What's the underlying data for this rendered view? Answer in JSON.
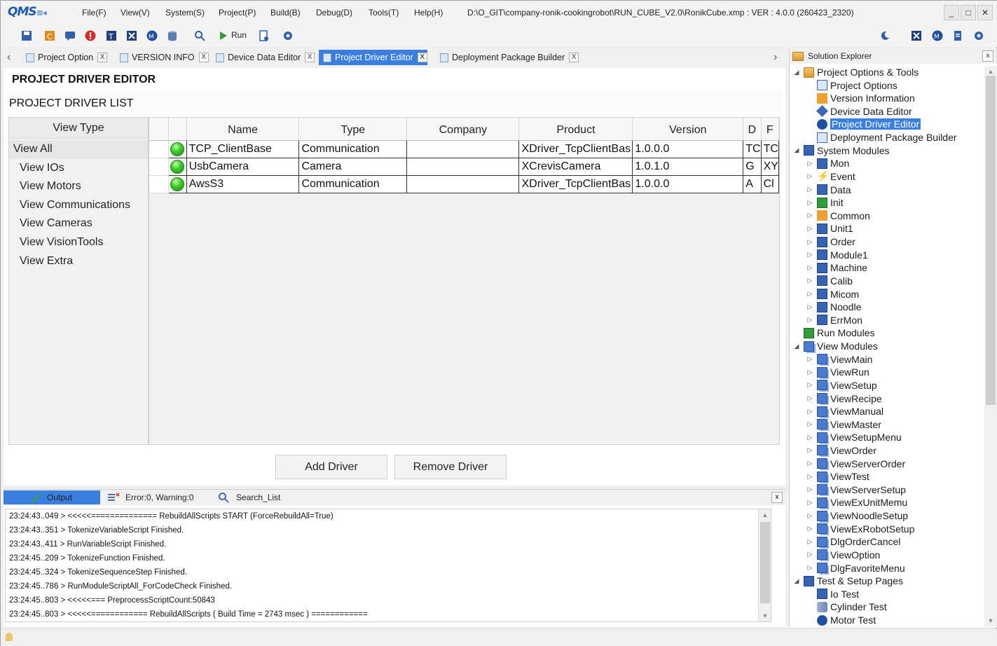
{
  "app": {
    "logo_text": "QMS",
    "path_text": "D:\\O_GIT\\company-ronik-cookingrobot\\RUN_CUBE_V2.0\\RonikCube.xmp :  VER : 4.0.0 (260423_2320)"
  },
  "menu": [
    "File(F)",
    "View(V)",
    "System(S)",
    "Project(P)",
    "Build(B)",
    "Debug(D)",
    "Tools(T)",
    "Help(H)"
  ],
  "toolbar": {
    "run_label": "Run"
  },
  "doc_tabs": [
    {
      "label": "Project Option",
      "close": "X"
    },
    {
      "label": "VERSION INFO",
      "close": "X"
    },
    {
      "label": "Device Data Editor",
      "close": "X"
    },
    {
      "label": "Project Driver Editor",
      "close": "X"
    },
    {
      "label": "Deployment Package Builder",
      "close": "X"
    }
  ],
  "editor": {
    "title": "PROJECT DRIVER EDITOR",
    "list_title": "PROJECT DRIVER LIST",
    "view_type_header": "View Type",
    "view_types": [
      "View All",
      "View IOs",
      "View Motors",
      "View Communications",
      "View Cameras",
      "View VisionTools",
      "View Extra"
    ],
    "columns": [
      "Name",
      "Type",
      "Company",
      "Product",
      "Version",
      "D",
      "F"
    ],
    "rows": [
      {
        "name": "TCP_ClientBase",
        "type": "Communication",
        "company": "",
        "product": "XDriver_TcpClientBas",
        "version": "1.0.0.0",
        "d": "TC",
        "f": "TC"
      },
      {
        "name": "UsbCamera",
        "type": "Camera",
        "company": "",
        "product": "XCrevisCamera",
        "version": "1.0.1.0",
        "d": "G",
        "f": "XY"
      },
      {
        "name": "AwsS3",
        "type": "Communication",
        "company": "",
        "product": "XDriver_TcpClientBas",
        "version": "1.0.0.0",
        "d": "A",
        "f": "Cl"
      }
    ],
    "add_button": "Add Driver",
    "remove_button": "Remove Driver"
  },
  "output": {
    "tabs": [
      "Output",
      "Error:0, Warning:0",
      "Search_List"
    ],
    "close": "x",
    "lines": [
      "23:24:43..049 > <<<<<============== RebuildAllScripts START   (ForceRebuildAll=True)",
      "23:24:43..351 > TokenizeVariableScript Finished.",
      "23:24:43..411 > RunVariableScript Finished.",
      "23:24:45..209 > TokenizeFunction Finished.",
      "23:24:45..324 > TokenizeSequenceStep Finished.",
      "23:24:45..786 > RunModuleScriptAll_ForCodeCheck Finished.",
      "23:24:45..803 > <<<<<=== PreprocessScriptCount:50843",
      "23:24:45..803 > <<<<<============ RebuildAllScripts ( Build Time = 2743 msec ) ============"
    ]
  },
  "solution_explorer": {
    "title": "Solution Explorer",
    "close": "x",
    "nodes": [
      {
        "label": "Project Options & Tools",
        "level": 0,
        "expander": "◢",
        "icon": "folder"
      },
      {
        "label": "Project Options",
        "level": 1,
        "expander": "",
        "icon": "doc"
      },
      {
        "label": "Version Information",
        "level": 1,
        "expander": "",
        "icon": "orange"
      },
      {
        "label": "Device Data Editor",
        "level": 1,
        "expander": "",
        "icon": "cube"
      },
      {
        "label": "Project Driver Editor",
        "level": 1,
        "expander": "",
        "icon": "ring",
        "selected": true
      },
      {
        "label": "Deployment Package Builder",
        "level": 1,
        "expander": "",
        "icon": "doc"
      },
      {
        "label": "System Modules",
        "level": 0,
        "expander": "◢",
        "icon": "mod"
      },
      {
        "label": "Mon",
        "level": 1,
        "expander": "▷",
        "icon": "mod"
      },
      {
        "label": "Event",
        "level": 1,
        "expander": "▷",
        "icon": "bolt"
      },
      {
        "label": "Data",
        "level": 1,
        "expander": "▷",
        "icon": "mod"
      },
      {
        "label": "Init",
        "level": 1,
        "expander": "▷",
        "icon": "check"
      },
      {
        "label": "Common",
        "level": 1,
        "expander": "▷",
        "icon": "orange"
      },
      {
        "label": "Unit1",
        "level": 1,
        "expander": "▷",
        "icon": "mod"
      },
      {
        "label": "Order",
        "level": 1,
        "expander": "▷",
        "icon": "mod"
      },
      {
        "label": "Module1",
        "level": 1,
        "expander": "▷",
        "icon": "mod"
      },
      {
        "label": "Machine",
        "level": 1,
        "expander": "▷",
        "icon": "mod"
      },
      {
        "label": "Calib",
        "level": 1,
        "expander": "▷",
        "icon": "mod"
      },
      {
        "label": "Micom",
        "level": 1,
        "expander": "▷",
        "icon": "mod"
      },
      {
        "label": "Noodle",
        "level": 1,
        "expander": "▷",
        "icon": "mod"
      },
      {
        "label": "ErrMon",
        "level": 1,
        "expander": "▷",
        "icon": "mod"
      },
      {
        "label": "Run Modules",
        "level": 0,
        "expander": "",
        "icon": "check"
      },
      {
        "label": "View Modules",
        "level": 0,
        "expander": "◢",
        "icon": "view"
      },
      {
        "label": "ViewMain",
        "level": 1,
        "expander": "▷",
        "icon": "view"
      },
      {
        "label": "ViewRun",
        "level": 1,
        "expander": "▷",
        "icon": "view"
      },
      {
        "label": "ViewSetup",
        "level": 1,
        "expander": "▷",
        "icon": "view"
      },
      {
        "label": "ViewRecipe",
        "level": 1,
        "expander": "▷",
        "icon": "view"
      },
      {
        "label": "ViewManual",
        "level": 1,
        "expander": "▷",
        "icon": "view"
      },
      {
        "label": "ViewMaster",
        "level": 1,
        "expander": "▷",
        "icon": "view"
      },
      {
        "label": "ViewSetupMenu",
        "level": 1,
        "expander": "▷",
        "icon": "view"
      },
      {
        "label": "ViewOrder",
        "level": 1,
        "expander": "▷",
        "icon": "view"
      },
      {
        "label": "ViewServerOrder",
        "level": 1,
        "expander": "▷",
        "icon": "view"
      },
      {
        "label": "ViewTest",
        "level": 1,
        "expander": "▷",
        "icon": "view"
      },
      {
        "label": "ViewServerSetup",
        "level": 1,
        "expander": "▷",
        "icon": "view"
      },
      {
        "label": "ViewExUnitMemu",
        "level": 1,
        "expander": "▷",
        "icon": "view"
      },
      {
        "label": "ViewNoodleSetup",
        "level": 1,
        "expander": "▷",
        "icon": "view"
      },
      {
        "label": "ViewExRobotSetup",
        "level": 1,
        "expander": "▷",
        "icon": "view"
      },
      {
        "label": "DlgOrderCancel",
        "level": 1,
        "expander": "▷",
        "icon": "view"
      },
      {
        "label": "ViewOption",
        "level": 1,
        "expander": "▷",
        "icon": "view"
      },
      {
        "label": "DlgFavoriteMenu",
        "level": 1,
        "expander": "▷",
        "icon": "view"
      },
      {
        "label": "Test & Setup Pages",
        "level": 0,
        "expander": "◢",
        "icon": "mod"
      },
      {
        "label": "Io Test",
        "level": 1,
        "expander": "",
        "icon": "mod"
      },
      {
        "label": "Cylinder Test",
        "level": 1,
        "expander": "",
        "icon": "cyl"
      },
      {
        "label": "Motor Test",
        "level": 1,
        "expander": "",
        "icon": "ring"
      }
    ]
  }
}
